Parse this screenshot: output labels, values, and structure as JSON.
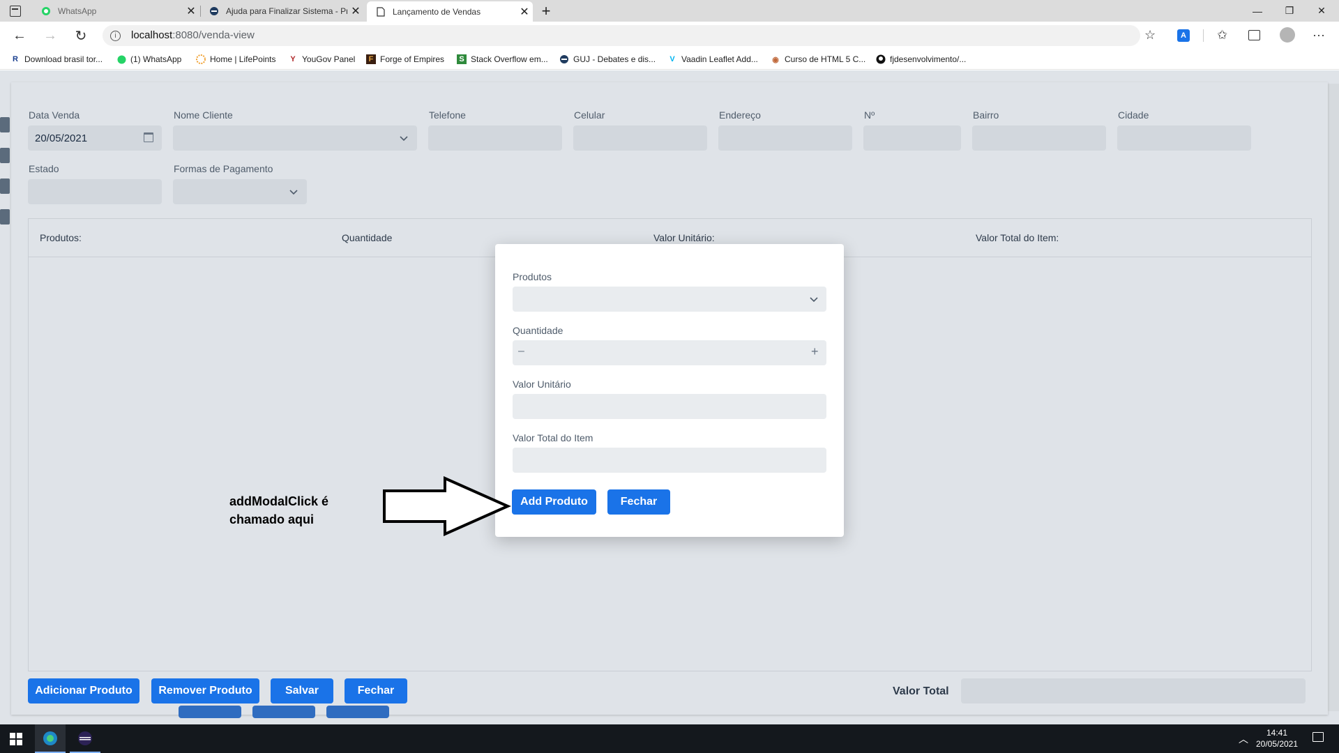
{
  "browser": {
    "tabs": [
      {
        "title": "WhatsApp",
        "icon": "whatsapp-icon",
        "active": false
      },
      {
        "title": "Ajuda para Finalizar Sistema - Pr",
        "icon": "guj-icon",
        "active": false
      },
      {
        "title": "Lançamento de Vendas",
        "icon": "page-icon",
        "active": true
      }
    ],
    "address": {
      "host": "localhost",
      "path": ":8080/venda-view"
    },
    "bookmarks": [
      {
        "label": "Download brasil tor...",
        "icon": "r-icon"
      },
      {
        "label": "(1) WhatsApp",
        "icon": "whatsapp-icon"
      },
      {
        "label": "Home | LifePoints",
        "icon": "lifepoints-icon"
      },
      {
        "label": "YouGov Panel",
        "icon": "yougov-icon"
      },
      {
        "label": "Forge of Empires",
        "icon": "forge-icon"
      },
      {
        "label": "Stack Overflow em...",
        "icon": "stackoverflow-icon"
      },
      {
        "label": "GUJ - Debates e dis...",
        "icon": "guj-icon"
      },
      {
        "label": "Vaadin Leaflet Add...",
        "icon": "vaadin-icon"
      },
      {
        "label": "Curso de HTML 5 C...",
        "icon": "eye-icon"
      },
      {
        "label": "fjdesenvolvimento/...",
        "icon": "github-icon"
      }
    ]
  },
  "form": {
    "data_venda": {
      "label": "Data Venda",
      "value": "20/05/2021"
    },
    "nome_cliente": {
      "label": "Nome Cliente",
      "value": ""
    },
    "telefone": {
      "label": "Telefone"
    },
    "celular": {
      "label": "Celular"
    },
    "endereco": {
      "label": "Endereço"
    },
    "numero": {
      "label": "Nº"
    },
    "bairro": {
      "label": "Bairro"
    },
    "cidade": {
      "label": "Cidade"
    },
    "estado": {
      "label": "Estado"
    },
    "formas_pagamento": {
      "label": "Formas de Pagamento",
      "value": ""
    }
  },
  "grid": {
    "columns": [
      "Produtos:",
      "Quantidade",
      "Valor Unitário:",
      "Valor Total do Item:"
    ],
    "rows": []
  },
  "footer": {
    "buttons": {
      "adicionar": "Adicionar Produto",
      "remover": "Remover Produto",
      "salvar": "Salvar",
      "fechar": "Fechar"
    },
    "total_label": "Valor Total",
    "total_value": ""
  },
  "modal": {
    "produtos_label": "Produtos",
    "quantidade_label": "Quantidade",
    "stepper_minus": "–",
    "stepper_plus": "+",
    "valor_unitario_label": "Valor Unitário",
    "valor_total_label": "Valor Total do Item",
    "add_button": "Add Produto",
    "close_button": "Fechar"
  },
  "annotation": {
    "line1": "addModalClick é",
    "line2": "chamado aqui"
  },
  "taskbar": {
    "time": "14:41",
    "date": "20/05/2021"
  },
  "colors": {
    "primary": "#1a73e8",
    "page_bg": "#dfe3e8",
    "field_bg": "#d2d7dd",
    "modal_field_bg": "#e9ecef"
  }
}
